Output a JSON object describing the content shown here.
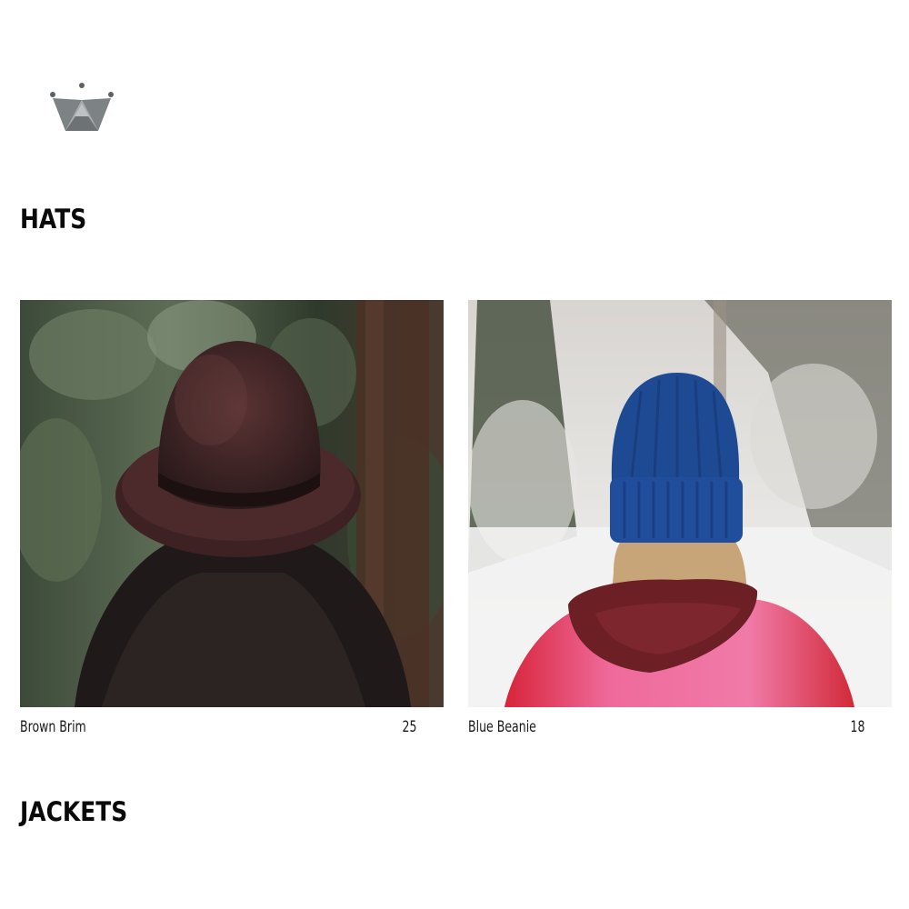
{
  "brand": {
    "logo_icon": "crown-icon",
    "logo_color": "#6b6f72"
  },
  "sections": [
    {
      "title": "HATS",
      "products": [
        {
          "name": "Brown Brim",
          "price": "25",
          "image_icon": "brown-brim-photo"
        },
        {
          "name": "Blue Beanie",
          "price": "18",
          "image_icon": "blue-beanie-photo"
        }
      ]
    },
    {
      "title": "JACKETS",
      "products": []
    }
  ]
}
